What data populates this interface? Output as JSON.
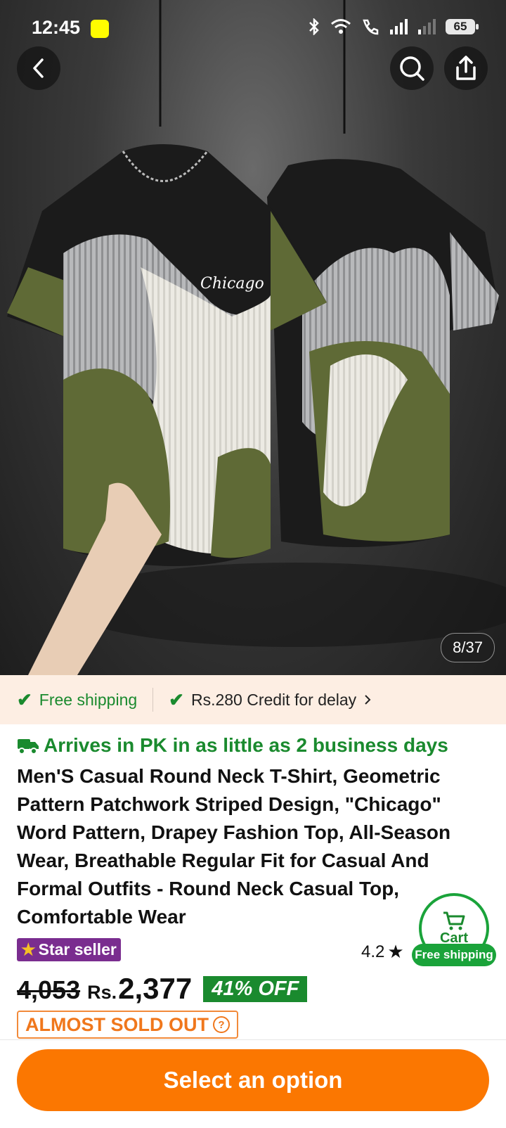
{
  "status_bar": {
    "time": "12:45",
    "battery": "65"
  },
  "gallery": {
    "counter": "8/37",
    "shirt_text": "Chicago"
  },
  "shipping_strip": {
    "free_shipping": "Free shipping",
    "credit": "Rs.280 Credit for delay"
  },
  "product": {
    "arrives": "Arrives in PK in as little as 2 business days",
    "title": "Men'S Casual Round Neck T-Shirt, Geometric Pattern Patchwork Striped Design, \"Chicago\" Word Pattern, Drapey Fashion Top, All-Season Wear, Breathable Regular Fit for Casual And Formal Outfits - Round Neck Casual Top, Comfortable Wear",
    "star_seller": "Star seller",
    "rating": "4.2",
    "old_price": "4,053",
    "currency": "Rs.",
    "price": "2,377",
    "discount": "41% OFF",
    "stock": "ALMOST SOLD OUT"
  },
  "cart": {
    "label": "Cart",
    "badge": "Free shipping"
  },
  "cta": {
    "label": "Select an option"
  },
  "colors": {
    "accent": "#fb7701",
    "green": "#1a8a2e",
    "purple": "#7a2d8f",
    "olive": "#5f6a36"
  },
  "icons": [
    "back-icon",
    "search-icon",
    "share-icon",
    "truck-icon",
    "check-icon",
    "chevron-right-icon",
    "star-icon",
    "cart-icon",
    "help-icon"
  ]
}
